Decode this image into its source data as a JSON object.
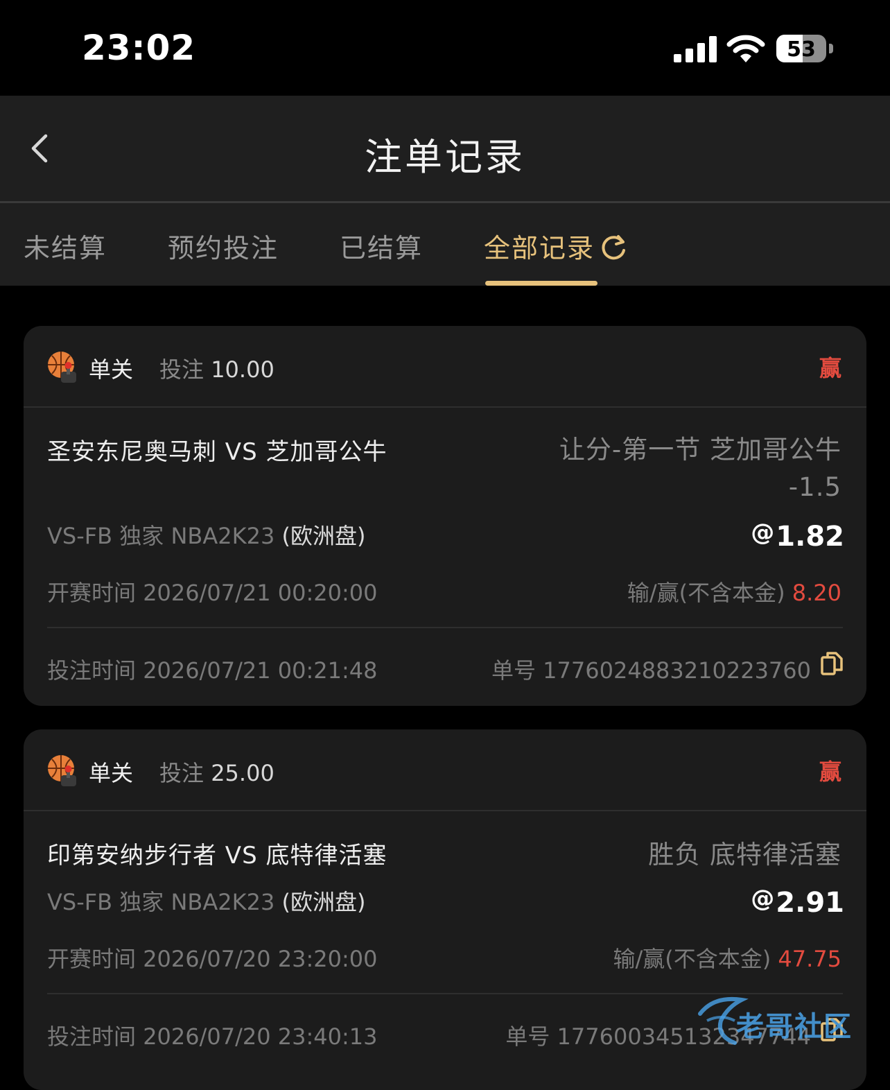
{
  "status_bar": {
    "time": "23:02",
    "battery": "53"
  },
  "header": {
    "title": "注单记录"
  },
  "tabs": [
    {
      "label": "未结算"
    },
    {
      "label": "预约投注"
    },
    {
      "label": "已结算"
    },
    {
      "label": "全部记录",
      "active": true
    }
  ],
  "bets": [
    {
      "bet_type": "单关",
      "stake_label": "投注",
      "stake": "10.00",
      "result": "赢",
      "match": "圣安东尼奥马刺 VS 芝加哥公牛",
      "selection": "让分-第一节 芝加哥公牛 -1.5",
      "league": "VS-FB 独家 NBA2K23",
      "market": "(欧洲盘)",
      "odds": "1.82",
      "start_time_label": "开赛时间",
      "start_time": "2026/07/21 00:20:00",
      "payout_label": "输/赢(不含本金)",
      "payout": "8.20",
      "bet_time_label": "投注时间",
      "bet_time": "2026/07/21 00:21:48",
      "order_label": "单号",
      "order_no": "1776024883210223760"
    },
    {
      "bet_type": "单关",
      "stake_label": "投注",
      "stake": "25.00",
      "result": "赢",
      "match": "印第安纳步行者 VS 底特律活塞",
      "selection": "胜负 底特律活塞",
      "league": "VS-FB 独家 NBA2K23",
      "market": "(欧洲盘)",
      "odds": "2.91",
      "start_time_label": "开赛时间",
      "start_time": "2026/07/20 23:20:00",
      "payout_label": "输/赢(不含本金)",
      "payout": "47.75",
      "bet_time_label": "投注时间",
      "bet_time": "2026/07/20 23:40:13",
      "order_label": "单号",
      "order_no": "177600345132347744"
    }
  ],
  "watermark": {
    "text": "老哥社区"
  },
  "colors": {
    "accent": "#e7c27c",
    "win": "#e34b3f",
    "card": "#1c1c1c",
    "bar": "#1f1f1f"
  }
}
